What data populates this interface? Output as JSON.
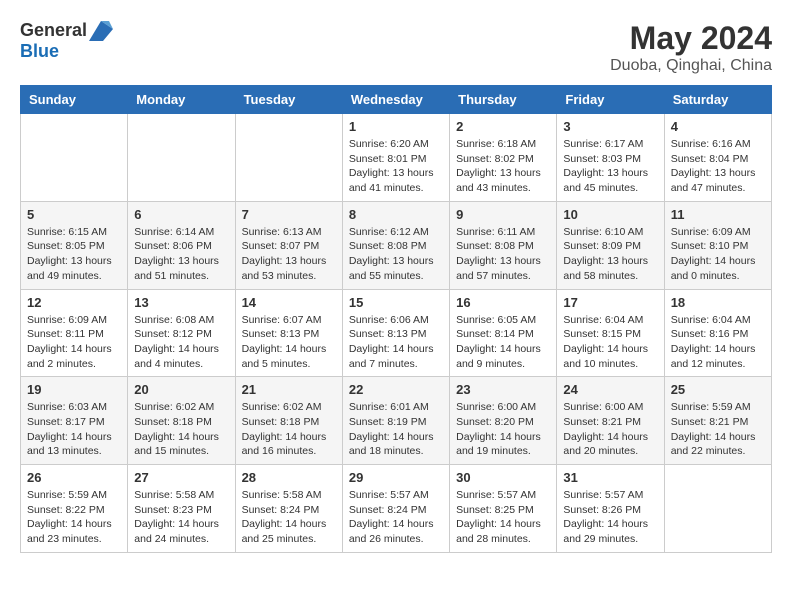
{
  "header": {
    "logo_general": "General",
    "logo_blue": "Blue",
    "month": "May 2024",
    "location": "Duoba, Qinghai, China"
  },
  "weekdays": [
    "Sunday",
    "Monday",
    "Tuesday",
    "Wednesday",
    "Thursday",
    "Friday",
    "Saturday"
  ],
  "weeks": [
    [
      {
        "day": "",
        "info": ""
      },
      {
        "day": "",
        "info": ""
      },
      {
        "day": "",
        "info": ""
      },
      {
        "day": "1",
        "info": "Sunrise: 6:20 AM\nSunset: 8:01 PM\nDaylight: 13 hours and 41 minutes."
      },
      {
        "day": "2",
        "info": "Sunrise: 6:18 AM\nSunset: 8:02 PM\nDaylight: 13 hours and 43 minutes."
      },
      {
        "day": "3",
        "info": "Sunrise: 6:17 AM\nSunset: 8:03 PM\nDaylight: 13 hours and 45 minutes."
      },
      {
        "day": "4",
        "info": "Sunrise: 6:16 AM\nSunset: 8:04 PM\nDaylight: 13 hours and 47 minutes."
      }
    ],
    [
      {
        "day": "5",
        "info": "Sunrise: 6:15 AM\nSunset: 8:05 PM\nDaylight: 13 hours and 49 minutes."
      },
      {
        "day": "6",
        "info": "Sunrise: 6:14 AM\nSunset: 8:06 PM\nDaylight: 13 hours and 51 minutes."
      },
      {
        "day": "7",
        "info": "Sunrise: 6:13 AM\nSunset: 8:07 PM\nDaylight: 13 hours and 53 minutes."
      },
      {
        "day": "8",
        "info": "Sunrise: 6:12 AM\nSunset: 8:08 PM\nDaylight: 13 hours and 55 minutes."
      },
      {
        "day": "9",
        "info": "Sunrise: 6:11 AM\nSunset: 8:08 PM\nDaylight: 13 hours and 57 minutes."
      },
      {
        "day": "10",
        "info": "Sunrise: 6:10 AM\nSunset: 8:09 PM\nDaylight: 13 hours and 58 minutes."
      },
      {
        "day": "11",
        "info": "Sunrise: 6:09 AM\nSunset: 8:10 PM\nDaylight: 14 hours and 0 minutes."
      }
    ],
    [
      {
        "day": "12",
        "info": "Sunrise: 6:09 AM\nSunset: 8:11 PM\nDaylight: 14 hours and 2 minutes."
      },
      {
        "day": "13",
        "info": "Sunrise: 6:08 AM\nSunset: 8:12 PM\nDaylight: 14 hours and 4 minutes."
      },
      {
        "day": "14",
        "info": "Sunrise: 6:07 AM\nSunset: 8:13 PM\nDaylight: 14 hours and 5 minutes."
      },
      {
        "day": "15",
        "info": "Sunrise: 6:06 AM\nSunset: 8:13 PM\nDaylight: 14 hours and 7 minutes."
      },
      {
        "day": "16",
        "info": "Sunrise: 6:05 AM\nSunset: 8:14 PM\nDaylight: 14 hours and 9 minutes."
      },
      {
        "day": "17",
        "info": "Sunrise: 6:04 AM\nSunset: 8:15 PM\nDaylight: 14 hours and 10 minutes."
      },
      {
        "day": "18",
        "info": "Sunrise: 6:04 AM\nSunset: 8:16 PM\nDaylight: 14 hours and 12 minutes."
      }
    ],
    [
      {
        "day": "19",
        "info": "Sunrise: 6:03 AM\nSunset: 8:17 PM\nDaylight: 14 hours and 13 minutes."
      },
      {
        "day": "20",
        "info": "Sunrise: 6:02 AM\nSunset: 8:18 PM\nDaylight: 14 hours and 15 minutes."
      },
      {
        "day": "21",
        "info": "Sunrise: 6:02 AM\nSunset: 8:18 PM\nDaylight: 14 hours and 16 minutes."
      },
      {
        "day": "22",
        "info": "Sunrise: 6:01 AM\nSunset: 8:19 PM\nDaylight: 14 hours and 18 minutes."
      },
      {
        "day": "23",
        "info": "Sunrise: 6:00 AM\nSunset: 8:20 PM\nDaylight: 14 hours and 19 minutes."
      },
      {
        "day": "24",
        "info": "Sunrise: 6:00 AM\nSunset: 8:21 PM\nDaylight: 14 hours and 20 minutes."
      },
      {
        "day": "25",
        "info": "Sunrise: 5:59 AM\nSunset: 8:21 PM\nDaylight: 14 hours and 22 minutes."
      }
    ],
    [
      {
        "day": "26",
        "info": "Sunrise: 5:59 AM\nSunset: 8:22 PM\nDaylight: 14 hours and 23 minutes."
      },
      {
        "day": "27",
        "info": "Sunrise: 5:58 AM\nSunset: 8:23 PM\nDaylight: 14 hours and 24 minutes."
      },
      {
        "day": "28",
        "info": "Sunrise: 5:58 AM\nSunset: 8:24 PM\nDaylight: 14 hours and 25 minutes."
      },
      {
        "day": "29",
        "info": "Sunrise: 5:57 AM\nSunset: 8:24 PM\nDaylight: 14 hours and 26 minutes."
      },
      {
        "day": "30",
        "info": "Sunrise: 5:57 AM\nSunset: 8:25 PM\nDaylight: 14 hours and 28 minutes."
      },
      {
        "day": "31",
        "info": "Sunrise: 5:57 AM\nSunset: 8:26 PM\nDaylight: 14 hours and 29 minutes."
      },
      {
        "day": "",
        "info": ""
      }
    ]
  ]
}
